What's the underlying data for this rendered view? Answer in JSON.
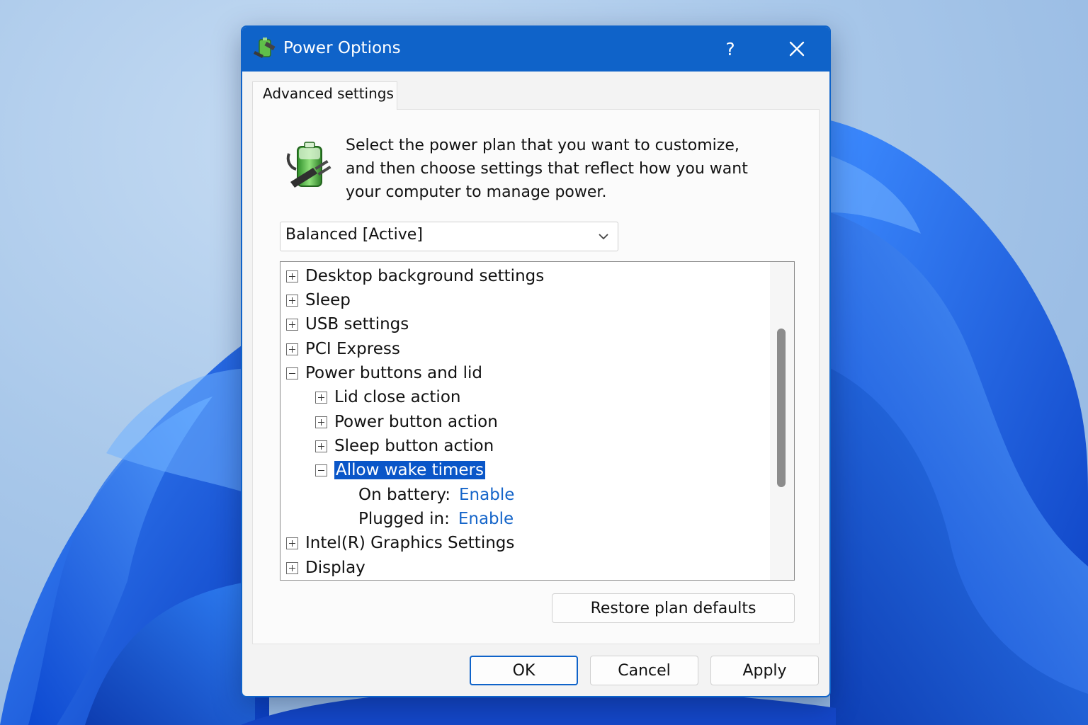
{
  "colors": {
    "titlebar": "#0f63c9",
    "selection": "#0a56c8",
    "link": "#1565c9",
    "desktop": "#a9c8ea",
    "bloom": "#1a56d8"
  },
  "window": {
    "title": "Power Options",
    "icon": "power-options-icon",
    "help_label": "?",
    "close_icon": "close-icon"
  },
  "tabs": [
    {
      "label": "Advanced settings",
      "active": true
    }
  ],
  "intro": {
    "icon": "battery-plug-icon",
    "lines": [
      "Select the power plan that you want to customize,",
      "and then choose settings that reflect how you want",
      "your computer to manage power."
    ]
  },
  "plan_select": {
    "value": "Balanced [Active]",
    "icon": "chevron-down-icon"
  },
  "tree": {
    "items": [
      {
        "label": "Desktop background settings",
        "state": "collapsed",
        "level": 0
      },
      {
        "label": "Sleep",
        "state": "collapsed",
        "level": 0
      },
      {
        "label": "USB settings",
        "state": "collapsed",
        "level": 0
      },
      {
        "label": "PCI Express",
        "state": "collapsed",
        "level": 0
      },
      {
        "label": "Power buttons and lid",
        "state": "expanded",
        "level": 0
      },
      {
        "label": "Lid close action",
        "state": "collapsed",
        "level": 1
      },
      {
        "label": "Power button action",
        "state": "collapsed",
        "level": 1
      },
      {
        "label": "Sleep button action",
        "state": "collapsed",
        "level": 1
      },
      {
        "label": "Allow wake timers",
        "state": "expanded",
        "level": 1,
        "selected": true
      },
      {
        "label": "On battery:",
        "value": "Enable",
        "level": 2
      },
      {
        "label": "Plugged in:",
        "value": "Enable",
        "level": 2
      },
      {
        "label": "Intel(R) Graphics Settings",
        "state": "collapsed",
        "level": 0
      },
      {
        "label": "Display",
        "state": "collapsed",
        "level": 0
      }
    ]
  },
  "buttons": {
    "restore": "Restore plan defaults",
    "ok": "OK",
    "cancel": "Cancel",
    "apply": "Apply"
  }
}
